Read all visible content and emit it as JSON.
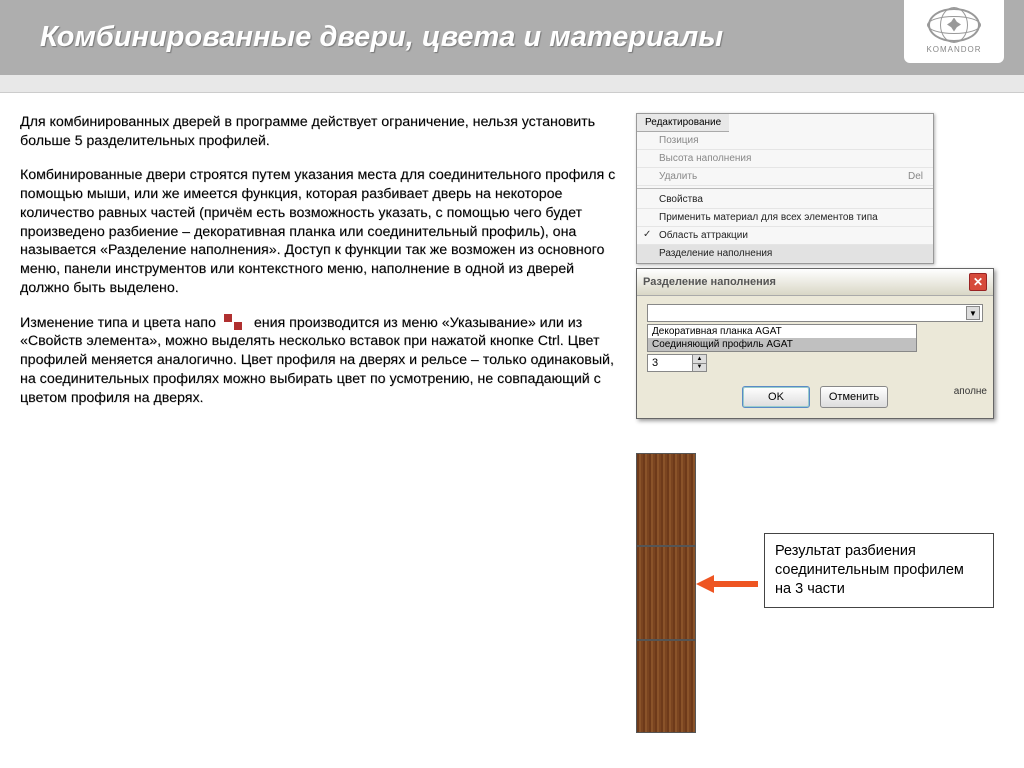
{
  "header": {
    "title": "Комбинированные двери, цвета и материалы"
  },
  "logo": {
    "brand": "KOMANDOR"
  },
  "body": {
    "p1": "Для комбинированных дверей в программе действует ограничение, нельзя установить больше 5 разделительных профилей.",
    "p2": "Комбинированные двери строятся путем указания места для соединительного профиля с помощью мыши, или же имеется функция, которая разбивает дверь на некоторое количество равных частей (причём есть возможность указать, с помощью чего будет произведено разбиение – декоративная планка или соединительный профиль), она называется «Разделение наполнения». Доступ к функции так же возможен из основного меню, панели инструментов или контекстного меню, наполнение в одной из дверей должно быть выделено.",
    "p3a": "Изменение типа и цвета напо",
    "p3b": "ения производится из меню «Указывание» или из «Свойств элемента», можно выделять несколько вставок при нажатой кнопке Ctrl. Цвет профилей меняется аналогично. Цвет профиля на дверях и рельсе – только одинаковый, на соединительных профилях можно выбирать цвет по усмотрению, не совпадающий с цветом профиля на дверях."
  },
  "context_menu": {
    "tab": "Редактирование",
    "items": [
      {
        "label": "Позиция",
        "enabled": false
      },
      {
        "label": "Высота наполнения",
        "enabled": false
      },
      {
        "label": "Удалить",
        "shortcut": "Del",
        "enabled": false,
        "sep": true
      },
      {
        "label": "Свойства",
        "enabled": true
      },
      {
        "label": "Применить материал для всех элементов типа",
        "enabled": true
      },
      {
        "label": "Область аттракции",
        "enabled": true,
        "checked": true
      },
      {
        "label": "Разделение наполнения",
        "enabled": true,
        "highlight": true
      }
    ]
  },
  "dialog": {
    "title": "Разделение наполнения",
    "options": [
      "Декоративная планка AGAT",
      "Соединяющий профиль AGAT"
    ],
    "side_text": "аполне",
    "count": "3",
    "ok": "OK",
    "cancel": "Отменить"
  },
  "callout": "Результат разбиения соединительным профилем на 3 части"
}
